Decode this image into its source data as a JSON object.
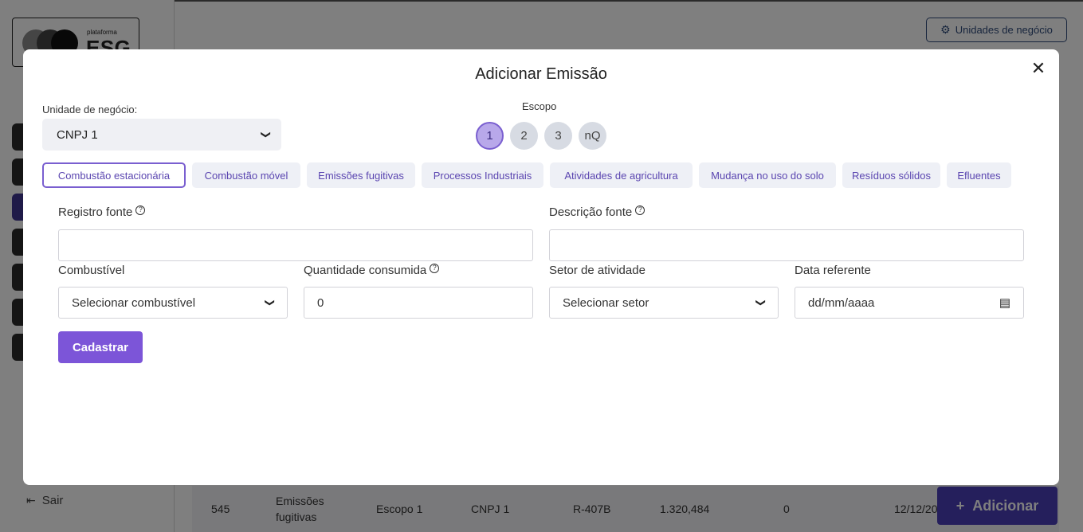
{
  "background": {
    "logo": {
      "small_text": "plataforma",
      "big_text": "ESG"
    },
    "sidebar": {
      "logout_label": "Sair",
      "logout_icon": "logout-icon"
    },
    "header": {
      "business_units_button": "Unidades de negócio",
      "business_units_icon": "gear-icon"
    },
    "table_row": [
      "545",
      "Emissões fugitivas",
      "Escopo 1",
      "CNPJ 1",
      "R-407B",
      "1.320,484",
      "0",
      "12/12/20"
    ],
    "add_button": {
      "label": "Adicionar",
      "icon": "+"
    }
  },
  "modal": {
    "title": "Adicionar Emissão",
    "close_icon": "close-icon",
    "business_unit": {
      "label": "Unidade de negócio:",
      "value": "CNPJ 1"
    },
    "scope": {
      "label": "Escopo",
      "options": [
        "1",
        "2",
        "3",
        "nQ"
      ],
      "selected": "1"
    },
    "tabs": [
      "Combustão estacionária",
      "Combustão móvel",
      "Emissões fugitivas",
      "Processos Industriais",
      "Atividades de agricultura",
      "Mudança no uso do solo",
      "Resíduos sólidos",
      "Efluentes"
    ],
    "active_tab": "Combustão estacionária",
    "form": {
      "registro_fonte": {
        "label": "Registro fonte",
        "value": ""
      },
      "descricao_fonte": {
        "label": "Descrição fonte",
        "value": ""
      },
      "combustivel": {
        "label": "Combustível",
        "value": "Selecionar combustível"
      },
      "quantidade": {
        "label": "Quantidade consumida",
        "value": "0"
      },
      "setor": {
        "label": "Setor de atividade",
        "value": "Selecionar setor"
      },
      "data": {
        "label": "Data referente",
        "value": "dd/mm/aaaa"
      },
      "submit_label": "Cadastrar"
    }
  },
  "colors": {
    "accent": "#7c55d8",
    "tab_text": "#5a45b0",
    "primary_dark": "#4b3fb8"
  }
}
